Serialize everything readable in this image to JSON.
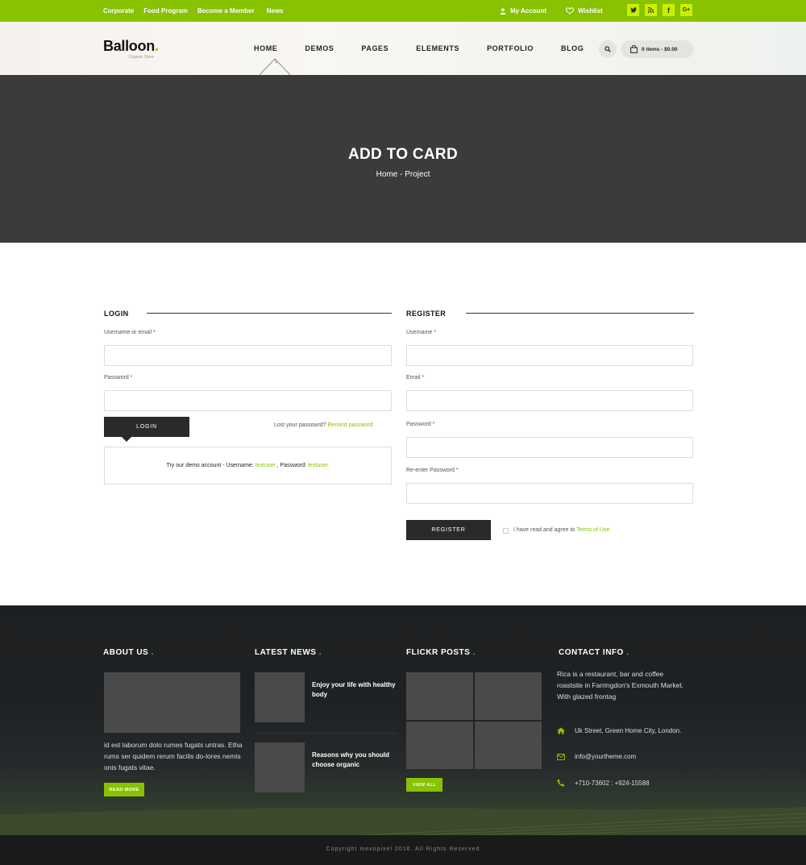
{
  "topbar": {
    "links": [
      "Corporate",
      "Food Program",
      "Become a Member",
      "News"
    ],
    "my_account": "My Account",
    "wishlist": "Wishlist",
    "social_icons": [
      "twitter-icon",
      "rss-icon",
      "facebook-icon",
      "google-plus-icon"
    ],
    "google_plus_label": "G+",
    "facebook_label": "f"
  },
  "header": {
    "logo_text": "Balloon",
    "logo_dot": ".",
    "logo_tagline": "Organic Store",
    "nav": [
      "HOME",
      "DEMOS",
      "PAGES",
      "ELEMENTS",
      "PORTFOLIO",
      "BLOG"
    ],
    "cart_label": "0 items - $0.00"
  },
  "hero": {
    "title": "ADD TO CARD",
    "breadcrumb": "Home - Project"
  },
  "login": {
    "heading": "LOGIN",
    "username_label": "Username or email *",
    "password_label": "Password *",
    "button": "LOGIN",
    "lost_text": "Lost your passowrd?",
    "remind_link": "Remind password",
    "demo_prefix": "Try our demo account - Username:",
    "demo_user": "testuser",
    "demo_mid": ", Password:",
    "demo_pass": "testuser."
  },
  "register": {
    "heading": "REGISTER",
    "username_label": "Username *",
    "email_label": "Email *",
    "password_label": "Password *",
    "reenter_label": "Re-enter Password *",
    "button": "REGISTER",
    "agree_text": "I have read and agree to",
    "terms_link": "Terms of Use"
  },
  "footer": {
    "about_heading": "ABOUT US",
    "about_text": "id est laborum dolo rumes fugats untras. Etha rums ser quidem rerum facilis do-lores nemis onis fugats vitae.",
    "read_more": "READ MORE",
    "news_heading": "LATEST NEWS",
    "news": [
      "Enjoy your life with healthy body",
      "Reasons why you should choose organic"
    ],
    "flickr_heading": "FLICKR POSTS",
    "view_all": "VIEW ALL",
    "contact_heading": "CONTACT INFO",
    "contact_text": "Rica is a restaurant, bar and coffee roastsite in Farringdon's Exmouth Market. With glazed frontag",
    "address": "Uk Street, Green Home City, London.",
    "email": "info@yourtheme.com",
    "phone": "+710-73602 : +924-15588",
    "heading_dot": ".",
    "copyright": "Copyright mexopixel 2016. All Rights Reserved"
  },
  "colors": {
    "accent": "#88c200",
    "dark": "#2a2a2a",
    "hero": "#3b3b3b"
  }
}
